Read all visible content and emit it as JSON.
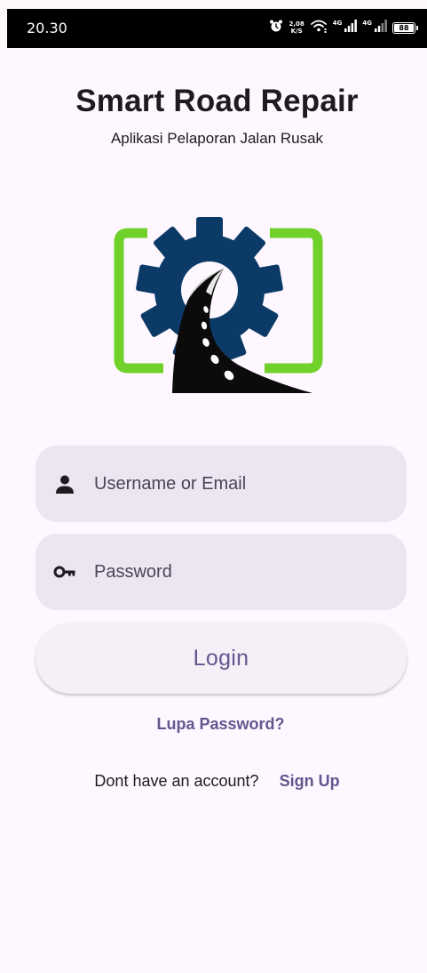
{
  "status_bar": {
    "time": "20.30",
    "net_speed_value": "2,08",
    "net_speed_unit": "K/S",
    "sim1_label": "4G",
    "sim2_label": "4G",
    "battery_level": "88"
  },
  "header": {
    "title": "Smart Road Repair",
    "subtitle": "Aplikasi Pelaporan Jalan Rusak"
  },
  "logo": {
    "icon": "gear-road-logo",
    "frame_color": "#6fd12a",
    "gear_color": "#0c3a66",
    "road_color": "#0b0b0b"
  },
  "form": {
    "username": {
      "placeholder": "Username or Email",
      "value": "",
      "icon": "person-icon"
    },
    "password": {
      "placeholder": "Password",
      "value": "",
      "icon": "key-icon"
    },
    "login_label": "Login",
    "forgot_label": "Lupa Password?",
    "signup_prompt": "Dont have an account?",
    "signup_label": "Sign Up"
  },
  "colors": {
    "background": "#fef7ff",
    "field_fill": "#ede5f1",
    "accent": "#65558f",
    "text": "#1d1b20"
  }
}
